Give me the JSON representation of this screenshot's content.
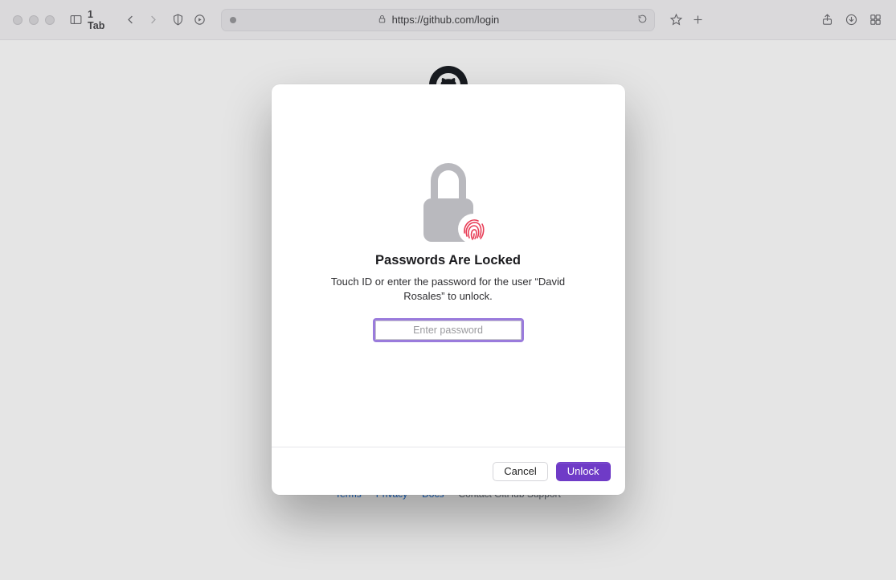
{
  "toolbar": {
    "tab_count_label": "1 Tab",
    "url": "https://github.com/login"
  },
  "footer": {
    "terms": "Terms",
    "privacy": "Privacy",
    "docs": "Docs",
    "support": "Contact GitHub Support"
  },
  "modal": {
    "title": "Passwords Are Locked",
    "subtitle": "Touch ID or enter the password for the user “David Rosales” to unlock.",
    "password_placeholder": "Enter password",
    "cancel_label": "Cancel",
    "unlock_label": "Unlock"
  }
}
